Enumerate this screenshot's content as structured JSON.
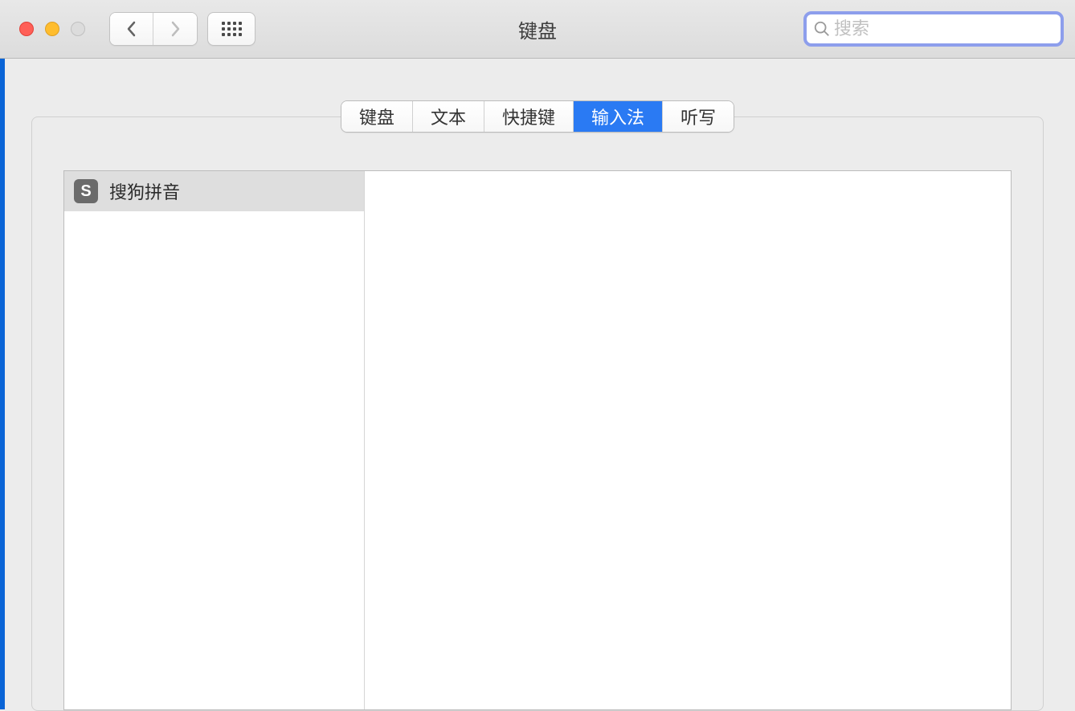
{
  "window": {
    "title": "键盘"
  },
  "search": {
    "placeholder": "搜索"
  },
  "tabs": [
    {
      "label": "键盘",
      "active": false
    },
    {
      "label": "文本",
      "active": false
    },
    {
      "label": "快捷键",
      "active": false
    },
    {
      "label": "输入法",
      "active": true
    },
    {
      "label": "听写",
      "active": false
    }
  ],
  "input_sources": [
    {
      "name": "搜狗拼音",
      "icon": "sogou"
    }
  ]
}
